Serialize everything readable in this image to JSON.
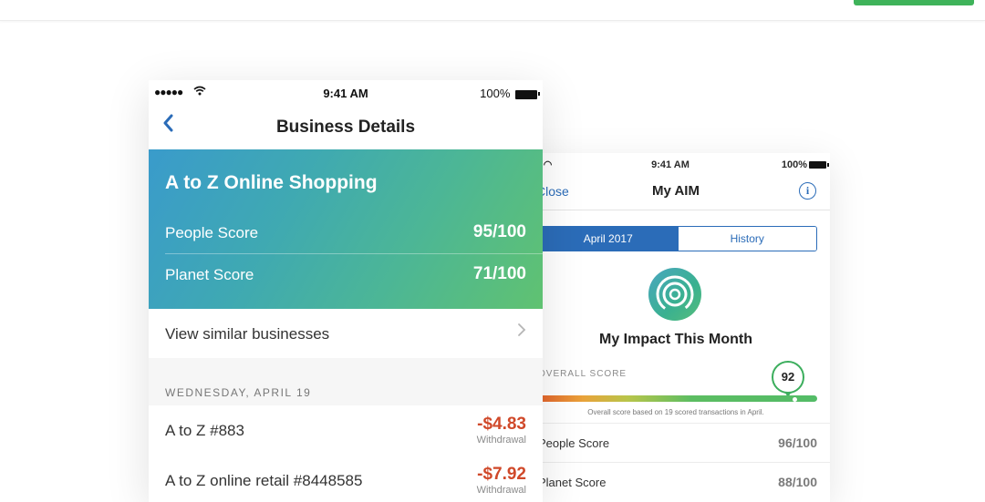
{
  "business_details": {
    "status": {
      "time": "9:41 AM",
      "battery": "100%"
    },
    "nav": {
      "title": "Business Details"
    },
    "business": {
      "name": "A to Z Online Shopping",
      "people_score_label": "People Score",
      "people_score_value": "95/100",
      "planet_score_label": "Planet Score",
      "planet_score_value": "71/100"
    },
    "similar_label": "View similar businesses",
    "section_date": "WEDNESDAY, APRIL 19",
    "transactions": [
      {
        "name": "A to Z #883",
        "amount": "-$4.83",
        "type": "Withdrawal"
      },
      {
        "name": "A to Z online retail #8448585",
        "amount": "-$7.92",
        "type": "Withdrawal"
      }
    ]
  },
  "my_aim": {
    "status": {
      "time": "9:41 AM",
      "battery": "100%"
    },
    "nav": {
      "close_label": "Close",
      "title": "My AIM",
      "info_label": "i"
    },
    "tabs": [
      {
        "label": "April 2017",
        "active": true
      },
      {
        "label": "History",
        "active": false
      }
    ],
    "heading": "My Impact This Month",
    "overall_label": "OVERALL SCORE",
    "overall_score": "92",
    "overall_score_fraction": 0.92,
    "overall_note": "Overall score based on 19 scored transactions in April.",
    "rows": [
      {
        "label": "People Score",
        "value": "96/100"
      },
      {
        "label": "Planet Score",
        "value": "88/100"
      }
    ]
  },
  "colors": {
    "accent_blue": "#2b6cb8",
    "negative_red": "#d0492a",
    "brand_green": "#3fb35a"
  }
}
